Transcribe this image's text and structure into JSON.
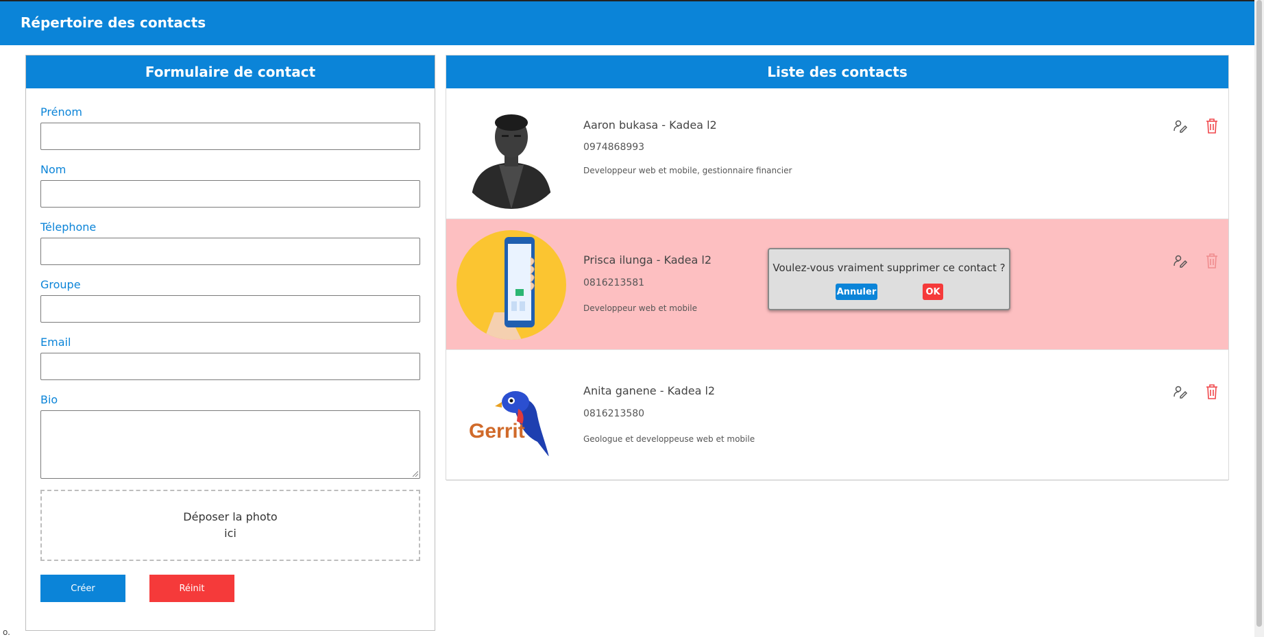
{
  "header": {
    "title": "Répertoire des contacts"
  },
  "form": {
    "title": "Formulaire de contact",
    "fields": [
      {
        "label": "Prénom",
        "value": ""
      },
      {
        "label": "Nom",
        "value": ""
      },
      {
        "label": "Télephone",
        "value": ""
      },
      {
        "label": "Groupe",
        "value": ""
      },
      {
        "label": "Email",
        "value": ""
      }
    ],
    "bio": {
      "label": "Bio",
      "value": ""
    },
    "dropzone": {
      "line1": "Déposer la photo",
      "line2": "ici"
    },
    "create_label": "Créer",
    "reset_label": "Réinit"
  },
  "list": {
    "title": "Liste des contacts",
    "contacts": [
      {
        "name": "Aaron bukasa - Kadea l2",
        "phone": "0974868993",
        "bio": "Developpeur web et mobile, gestionnaire financier",
        "avatar": "portrait-photo"
      },
      {
        "name": "Prisca ilunga - Kadea l2",
        "phone": "0816213581",
        "bio": "Developpeur web et mobile",
        "avatar": "mobile-first-illustration",
        "highlighted": true
      },
      {
        "name": "Anita ganene - Kadea l2",
        "phone": "0816213580",
        "bio": "Geologue et developpeuse web et mobile",
        "avatar": "gerrit-logo"
      }
    ]
  },
  "confirm_dialog": {
    "message": "Voulez-vous vraiment supprimer ce contact ?",
    "cancel_label": "Annuler",
    "ok_label": "OK"
  },
  "footer": {
    "corner_text": "o."
  },
  "colors": {
    "primary": "#0b84d8",
    "danger": "#f53a3a",
    "highlight_row": "#fdbfc1"
  },
  "icons": {
    "edit": "user-edit-icon",
    "delete": "trash-icon"
  }
}
